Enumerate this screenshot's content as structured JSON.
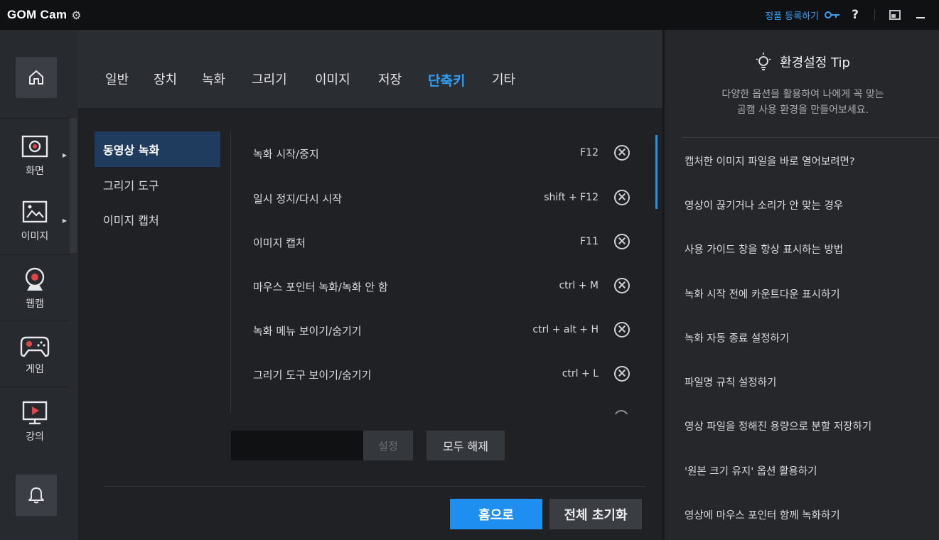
{
  "app": {
    "name": "GOM Cam"
  },
  "titlebar": {
    "register_label": "정품 등록하기",
    "help_label": "?"
  },
  "rail": {
    "items": [
      {
        "label": "화면"
      },
      {
        "label": "이미지"
      },
      {
        "label": "웹캠"
      },
      {
        "label": "게임"
      },
      {
        "label": "강의"
      }
    ]
  },
  "tabs": [
    "일반",
    "장치",
    "녹화",
    "그리기",
    "이미지",
    "저장",
    "단축키",
    "기타"
  ],
  "active_tab": "단축키",
  "categories": [
    "동영상 녹화",
    "그리기 도구",
    "이미지 캡처"
  ],
  "active_category": "동영상 녹화",
  "shortcuts": [
    {
      "name": "녹화 시작/중지",
      "key": "F12"
    },
    {
      "name": "일시 정지/다시 시작",
      "key": "shift + F12"
    },
    {
      "name": "이미지 캡처",
      "key": "F11"
    },
    {
      "name": "마우스 포인터 녹화/녹화 안 함",
      "key": "ctrl + M"
    },
    {
      "name": "녹화 메뉴 보이기/숨기기",
      "key": "ctrl + alt + H"
    },
    {
      "name": "그리기 도구 보이기/숨기기",
      "key": "ctrl + L"
    }
  ],
  "editor": {
    "key_value": "",
    "set_label": "설정",
    "clear_all_label": "모두 해제"
  },
  "footer": {
    "home_label": "홈으로",
    "reset_label": "전체 초기화"
  },
  "tips": {
    "title": "환경설정 Tip",
    "subtitle_line1": "다양한 옵션을 활용하여 나에게 꼭 맞는",
    "subtitle_line2": "곰캠 사용 환경을 만들어보세요.",
    "items": [
      "캡처한 이미지 파일을 바로 열어보려면?",
      "영상이 끊기거나 소리가 안 맞는 경우",
      "사용 가이드 창을 항상 표시하는 방법",
      "녹화 시작 전에 카운트다운 표시하기",
      "녹화 자동 종료 설정하기",
      "파일명 규칙 설정하기",
      "영상 파일을 정해진 용량으로 분할 저장하기",
      "'원본 크기 유지' 옵션 활용하기",
      "영상에 마우스 포인터 함께 녹화하기"
    ]
  },
  "colors": {
    "accent": "#1e8ff0",
    "active_tab": "#2fa0f8",
    "active_category_bg": "#1f3c5e"
  }
}
